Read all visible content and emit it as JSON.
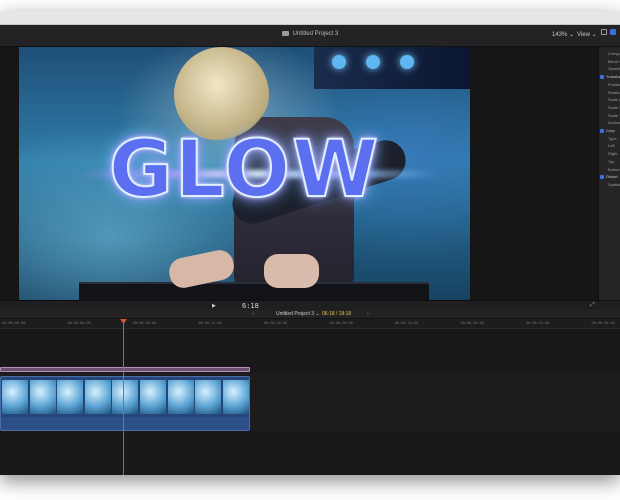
{
  "titlebar": {
    "project_title": "Untitled Project 3",
    "zoom": "143%",
    "zoom_chevron": "⌄",
    "view_label": "View",
    "view_chevron": "⌄"
  },
  "viewer": {
    "overlay_title": "GLOW"
  },
  "inspector": {
    "items": [
      {
        "label": "Compositing",
        "kind": "row"
      },
      {
        "label": "Blend Mode",
        "kind": "row"
      },
      {
        "label": "Opacity",
        "kind": "row"
      },
      {
        "label": "Transform",
        "kind": "head"
      },
      {
        "label": "Position",
        "kind": "row"
      },
      {
        "label": "Rotation",
        "kind": "row"
      },
      {
        "label": "Scale (All)",
        "kind": "row"
      },
      {
        "label": "Scale X",
        "kind": "row"
      },
      {
        "label": "Scale Y",
        "kind": "row"
      },
      {
        "label": "Anchor",
        "kind": "row"
      },
      {
        "label": "Crop",
        "kind": "head"
      },
      {
        "label": "Type",
        "kind": "row"
      },
      {
        "label": "Left",
        "kind": "row"
      },
      {
        "label": "Right",
        "kind": "row"
      },
      {
        "label": "Top",
        "kind": "row"
      },
      {
        "label": "Bottom",
        "kind": "row"
      },
      {
        "label": "Distort",
        "kind": "head"
      },
      {
        "label": "Spatial",
        "kind": "row"
      }
    ]
  },
  "playback": {
    "play_icon": "▶",
    "timecode": "6:18",
    "fullscreen_icon": "⤢"
  },
  "timeline": {
    "project_name": "Untitled Project 3",
    "project_chevron": "⌄",
    "duration": "06:18 / 18:18",
    "nav_back": "‹",
    "nav_forward": "›",
    "ruler_labels": [
      "00:00:00:00",
      "00:00:04:00",
      "00:00:08:00",
      "00:00:12:00",
      "00:00:16:00",
      "00:00:20:00",
      "00:00:24:00",
      "00:00:28:00",
      "00:00:32:00",
      "00:00:36:00"
    ]
  },
  "colors": {
    "accent": "#3b6fe0",
    "playhead": "#d4552e",
    "title_clip": "#6a4f6e",
    "video_clip": "#26467a"
  }
}
